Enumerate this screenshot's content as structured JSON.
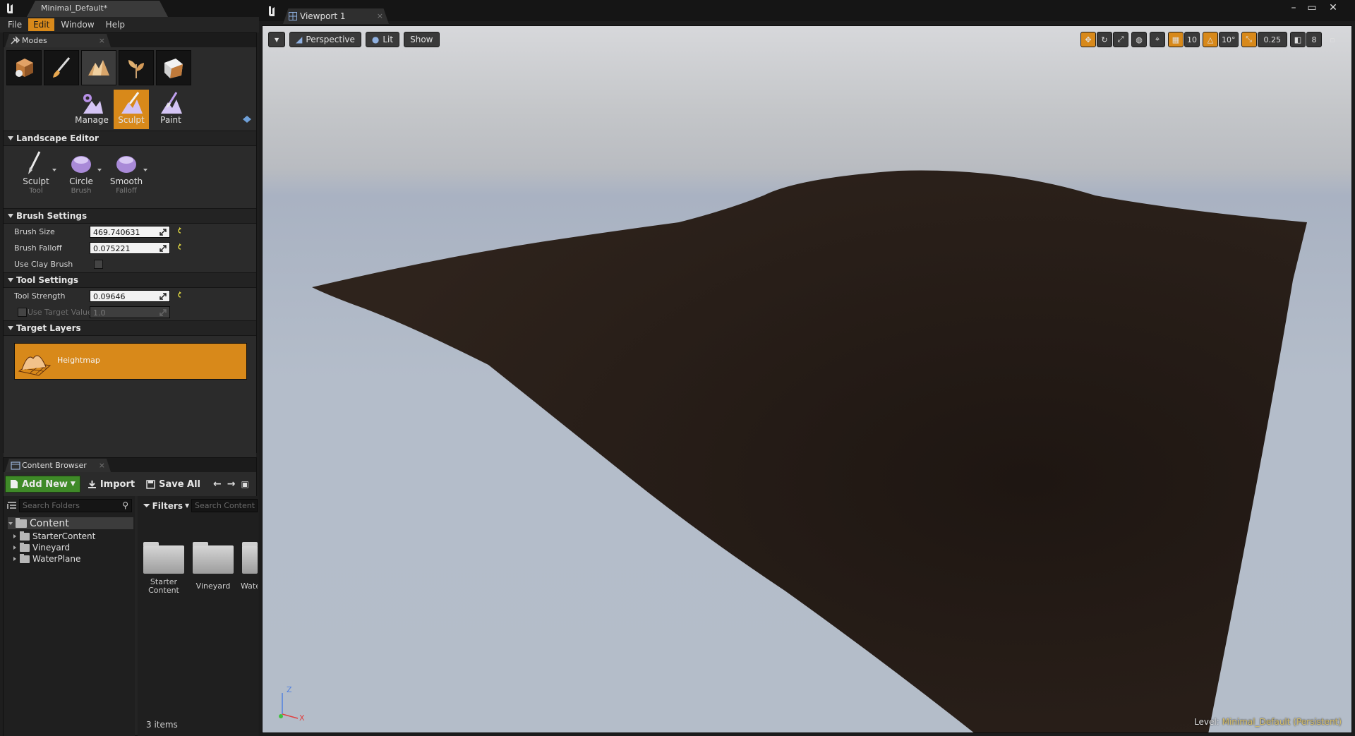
{
  "left_window": {
    "document_tab": "Minimal_Default*",
    "menu": [
      "File",
      "Edit",
      "Window",
      "Help"
    ],
    "active_menu_index": 1
  },
  "modes_panel": {
    "tab_title": "Modes",
    "submodes": [
      "Manage",
      "Sculpt",
      "Paint"
    ],
    "selected_submode": "Sculpt"
  },
  "landscape_editor": {
    "header": "Landscape Editor",
    "tools": [
      {
        "label": "Sculpt",
        "sub": "Tool"
      },
      {
        "label": "Circle",
        "sub": "Brush"
      },
      {
        "label": "Smooth",
        "sub": "Falloff"
      }
    ]
  },
  "brush_settings": {
    "header": "Brush Settings",
    "brush_size_label": "Brush Size",
    "brush_size_value": "469.740631",
    "brush_falloff_label": "Brush Falloff",
    "brush_falloff_value": "0.075221",
    "use_clay_brush_label": "Use Clay Brush"
  },
  "tool_settings": {
    "header": "Tool Settings",
    "tool_strength_label": "Tool Strength",
    "tool_strength_value": "0.09646",
    "use_target_value_label": "Use Target Value",
    "target_value": "1.0"
  },
  "target_layers": {
    "header": "Target Layers",
    "layers": [
      "Heightmap"
    ]
  },
  "content_browser": {
    "tab_title": "Content Browser",
    "add_new": "Add New",
    "import": "Import",
    "save_all": "Save All",
    "search_folders_placeholder": "Search Folders",
    "filters": "Filters",
    "search_content_placeholder": "Search Content",
    "tree_root": "Content",
    "tree_children": [
      "StarterContent",
      "Vineyard",
      "WaterPlane"
    ],
    "assets": [
      {
        "line1": "Starter",
        "line2": "Content"
      },
      {
        "line1": "Vineyard",
        "line2": ""
      },
      {
        "line1": "Wate",
        "line2": ""
      }
    ],
    "item_count": "3 items"
  },
  "viewport": {
    "tab_title": "Viewport 1",
    "view_mode": "Perspective",
    "lighting": "Lit",
    "show": "Show",
    "grid_snap": "10",
    "rotation_snap": "10°",
    "scale_snap": "0.25",
    "camera_speed": "8",
    "axis_z": "Z",
    "axis_x": "X",
    "level_prefix": "Level:",
    "level_name": "Minimal_Default (Persistent)"
  },
  "colors": {
    "accent": "#d8891a",
    "add_new_green": "#3f8a28",
    "terrain": "#2a1e18"
  }
}
